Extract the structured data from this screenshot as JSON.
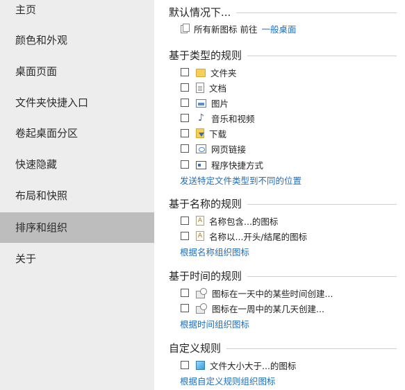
{
  "sidebar": {
    "items": [
      {
        "label": "主页"
      },
      {
        "label": "颜色和外观"
      },
      {
        "label": "桌面页面"
      },
      {
        "label": "文件夹快捷入口"
      },
      {
        "label": "卷起桌面分区"
      },
      {
        "label": "快速隐藏"
      },
      {
        "label": "布局和快照"
      },
      {
        "label": "排序和组织",
        "active": true
      },
      {
        "label": "关于"
      }
    ]
  },
  "default": {
    "title": "默认情况下...",
    "text": "所有新图标 前往",
    "link": "一般桌面",
    "icon": "stacked-pages-icon"
  },
  "type_rules": {
    "title": "基于类型的规则",
    "items": [
      {
        "label": "文件夹",
        "icon": "folder-icon",
        "checked": false
      },
      {
        "label": "文档",
        "icon": "document-icon",
        "checked": false
      },
      {
        "label": "图片",
        "icon": "picture-icon",
        "checked": false
      },
      {
        "label": "音乐和视频",
        "icon": "music-note-icon",
        "checked": false
      },
      {
        "label": "下载",
        "icon": "download-folder-icon",
        "checked": false
      },
      {
        "label": "网页链接",
        "icon": "web-link-icon",
        "checked": false
      },
      {
        "label": "程序快捷方式",
        "icon": "program-shortcut-icon",
        "checked": false
      }
    ],
    "link": "发送特定文件类型到不同的位置"
  },
  "name_rules": {
    "title": "基于名称的规则",
    "items": [
      {
        "label": "名称包含...的图标",
        "icon": "text-file-icon",
        "checked": false
      },
      {
        "label": "名称以...开头/结尾的图标",
        "icon": "text-file-icon",
        "checked": false
      }
    ],
    "link": "根据名称组织图标"
  },
  "time_rules": {
    "title": "基于时间的规则",
    "items": [
      {
        "label": "图标在一天中的某些时间创建...",
        "icon": "clock-calendar-icon",
        "checked": false
      },
      {
        "label": "图标在一周中的某几天创建...",
        "icon": "clock-calendar-icon",
        "checked": false
      }
    ],
    "link": "根据时间组织图标"
  },
  "custom_rules": {
    "title": "自定义规则",
    "items": [
      {
        "label": "文件大小大于...的图标",
        "icon": "cube-icon",
        "checked": false
      }
    ],
    "link": "根据自定义规则组织图标"
  }
}
